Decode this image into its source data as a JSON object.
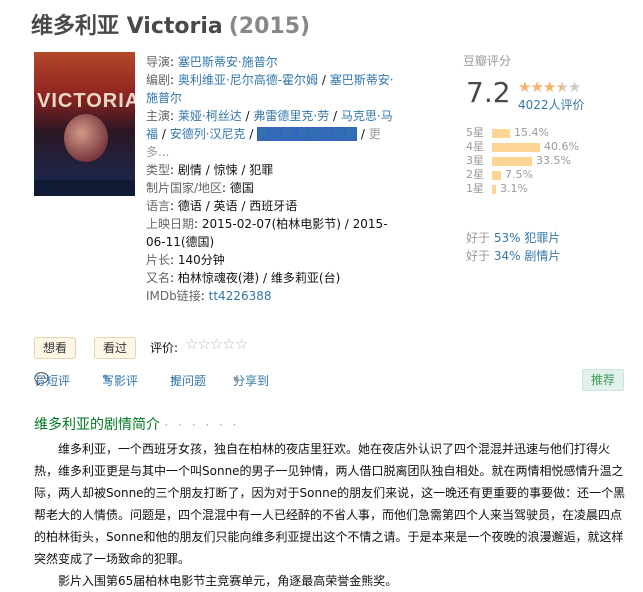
{
  "title": {
    "name": "维多利亚 Victoria",
    "year": "(2015)"
  },
  "poster": {
    "title_text": "VICTORIA"
  },
  "info": {
    "director_label": "导演",
    "director": "塞巴斯蒂安·施普尔",
    "writer_label": "编剧",
    "writers": [
      "奥利维亚·尼尔高德-霍尔姆",
      "塞巴斯蒂安·施普尔"
    ],
    "cast_label": "主演",
    "cast": [
      "莱娅·柯丝达",
      "弗雷德里克·劳",
      "马克思·马福",
      "安德列·汉尼克",
      "弗兰兹·罗格沃斯基"
    ],
    "cast_more": "更多...",
    "genre_label": "类型",
    "genres": [
      "剧情",
      "惊悚",
      "犯罪"
    ],
    "country_label": "制片国家/地区",
    "country": "德国",
    "language_label": "语言",
    "language": "德语 / 英语 / 西班牙语",
    "release_label": "上映日期",
    "release": [
      "2015-02-07(柏林电影节)",
      "2015-06-11(德国)"
    ],
    "runtime_label": "片长",
    "runtime": "140分钟",
    "aka_label": "又名",
    "aka": "柏林惊魂夜(港) / 维多莉亚(台)",
    "imdb_label": "IMDb链接",
    "imdb": "tt4226388"
  },
  "rating": {
    "title": "豆瓣评分",
    "score": "7.2",
    "votes": "4022人评价",
    "stars_filled": 3.5,
    "distribution": [
      {
        "label": "5星",
        "pct": "15.4%",
        "value": 15.4
      },
      {
        "label": "4星",
        "pct": "40.6%",
        "value": 40.6
      },
      {
        "label": "3星",
        "pct": "33.5%",
        "value": 33.5
      },
      {
        "label": "2星",
        "pct": "7.5%",
        "value": 7.5
      },
      {
        "label": "1星",
        "pct": "3.1%",
        "value": 3.1
      }
    ],
    "better_than": [
      {
        "prefix": "好于",
        "pct": "53%",
        "genre": "犯罪片"
      },
      {
        "prefix": "好于",
        "pct": "34%",
        "genre": "剧情片"
      }
    ]
  },
  "interest": {
    "want_label": "想看",
    "seen_label": "看过",
    "rate_label": "评价:"
  },
  "actions": {
    "short_review": "写短评",
    "review": "写影评",
    "question": "提问题",
    "share": "分享到",
    "recommend": "推荐"
  },
  "summary": {
    "title": "维多利亚的剧情简介",
    "dots": "· · · · · ·",
    "paragraphs": [
      "维多利亚，一个西班牙女孩，独自在柏林的夜店里狂欢。她在夜店外认识了四个混混并迅速与他们打得火热，维多利亚更是与其中一个叫Sonne的男子一见钟情，两人借口脱离团队独自相处。就在两情相悦感情升温之际，两人却被Sonne的三个朋友打断了，因为对于Sonne的朋友们来说，这一晚还有更重要的事要做：还一个黑帮老大的人情债。问题是，四个混混中有一人已经醉的不省人事，而他们急需第四个人来当驾驶员，在凌晨四点的柏林街头，Sonne和他的朋友们只能向维多利亚提出这个不情之请。于是本来是一个夜晚的浪漫邂逅，就这样突然变成了一场致命的犯罪。",
      "影片入围第65届柏林电影节主竞赛单元，角逐最高荣誉金熊奖。"
    ]
  },
  "colors": {
    "link": "#3377aa",
    "star": "#f6b26b",
    "bar": "#ffd596",
    "section": "#007722"
  }
}
